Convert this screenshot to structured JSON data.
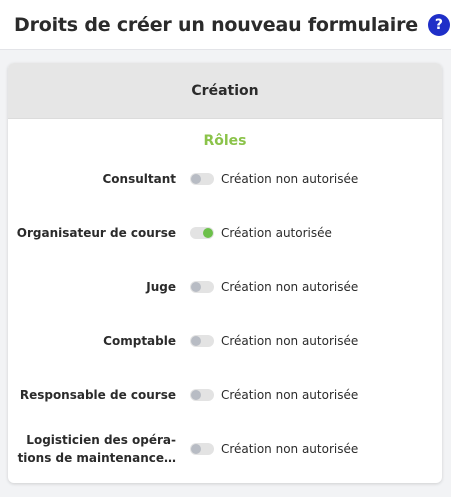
{
  "header": {
    "title": "Droits de créer un nouveau formulaire",
    "help_glyph": "?"
  },
  "card": {
    "title": "Création",
    "section_title": "Rôles"
  },
  "colors": {
    "accent_green": "#8bc34a",
    "toggle_on": "#6cc04a",
    "help_blue": "#1f2fc8"
  },
  "roles": [
    {
      "label": "Consultant",
      "enabled": false,
      "status": "Création non autorisée"
    },
    {
      "label": "Organisateur de course",
      "enabled": true,
      "status": "Création autorisée"
    },
    {
      "label": "Juge",
      "enabled": false,
      "status": "Création non autorisée"
    },
    {
      "label": "Comptable",
      "enabled": false,
      "status": "Création non autorisée"
    },
    {
      "label": "Responsable de course",
      "enabled": false,
      "status": "Création non autorisée"
    },
    {
      "label_line1": "Logisticien des opéra-",
      "label_line2": "tions de maintenance…",
      "enabled": false,
      "status": "Création non autorisée"
    }
  ]
}
